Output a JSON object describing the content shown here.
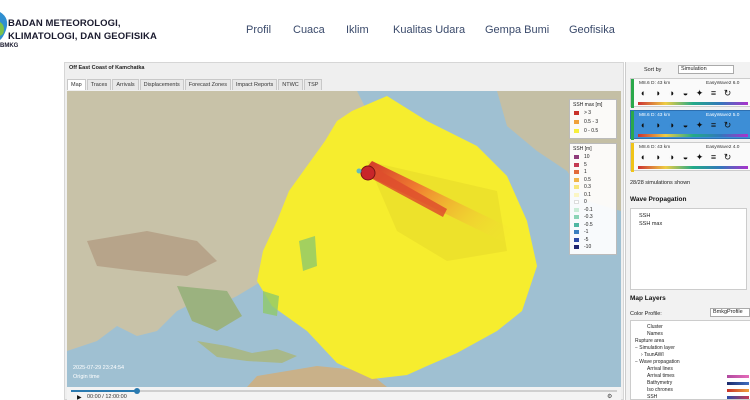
{
  "header": {
    "logo_line1": "BADAN METEOROLOGI,",
    "logo_line2": "KLIMATOLOGI, DAN GEOFISIKA",
    "logo_sub": "BMKG",
    "nav": [
      "Profil",
      "Cuaca",
      "Iklim",
      "Kualitas Udara",
      "Gempa Bumi",
      "Geofisika"
    ]
  },
  "app": {
    "title": "Off East Coast of Kamchatka",
    "tabs": [
      "Map",
      "Traces",
      "Arrivals",
      "Displacements",
      "Forecast Zones",
      "Impact Reports",
      "NTWC",
      "TSP"
    ],
    "active_tab": "Map",
    "timestamp": "2025-07-29 23:24:54",
    "origin_label": "Origin time",
    "playback_time": "00:00 / 12:00:00",
    "progress": 0.12
  },
  "legend_max": {
    "title": "SSH max [m]",
    "items": [
      {
        "label": "> 3",
        "color": "#c8312a"
      },
      {
        "label": "0.5 - 3",
        "color": "#f0a13a"
      },
      {
        "label": "0 - 0.5",
        "color": "#f7ef3b"
      }
    ]
  },
  "legend_ssh": {
    "title": "SSH [m]",
    "items": [
      {
        "label": "10",
        "color": "#8e3b7a"
      },
      {
        "label": "5",
        "color": "#c43a52"
      },
      {
        "label": "1",
        "color": "#e26a3a"
      },
      {
        "label": "0.5",
        "color": "#f0b64a"
      },
      {
        "label": "0.3",
        "color": "#f7e67a"
      },
      {
        "label": "0.1",
        "color": "#fbf6c4"
      },
      {
        "label": "0",
        "color": "#ffffff"
      },
      {
        "label": "-0.1",
        "color": "#c9ecd6"
      },
      {
        "label": "-0.3",
        "color": "#8ad3b5"
      },
      {
        "label": "-0.5",
        "color": "#4fb7a2"
      },
      {
        "label": "-1",
        "color": "#3a7fc0"
      },
      {
        "label": "-5",
        "color": "#2b4aa8"
      },
      {
        "label": "-10",
        "color": "#1d2470"
      }
    ]
  },
  "right_panel": {
    "sort_label": "Sort by",
    "sort_value": "Simulation",
    "simulations": [
      {
        "header": "M8.6  D: 43 km",
        "model": "EasyWave2 6.0",
        "accent": "#2aa84a",
        "selected": false
      },
      {
        "header": "M8.6  D: 43 km",
        "model": "EasyWave2 5.0",
        "accent": "#2aa84a",
        "selected": true
      },
      {
        "header": "M8.6  D: 43 km",
        "model": "EasyWave2 4.0",
        "accent": "#f0c419",
        "selected": false
      }
    ],
    "sim_count": "28/28 simulations shown",
    "wave_title": "Wave Propagation",
    "wave_items": [
      "SSH",
      "SSH max"
    ],
    "layers_title": "Map Layers",
    "color_profile_label": "Color Profile:",
    "color_profile_value": "BmkgProfile",
    "layers": [
      {
        "label": "Cluster",
        "indent": 2
      },
      {
        "label": "Names",
        "indent": 2
      },
      {
        "label": "Rupture area",
        "indent": 0
      },
      {
        "label": "− Simulation layer",
        "indent": 0
      },
      {
        "label": "› TsunAWI",
        "indent": 1
      },
      {
        "label": "− Wave propagation",
        "indent": 0
      },
      {
        "label": "Arrival lines",
        "indent": 2
      },
      {
        "label": "Arrival times",
        "indent": 2
      },
      {
        "label": "Bathymetry",
        "indent": 2
      },
      {
        "label": "Iso chrones",
        "indent": 2
      },
      {
        "label": "SSH",
        "indent": 2
      }
    ]
  }
}
